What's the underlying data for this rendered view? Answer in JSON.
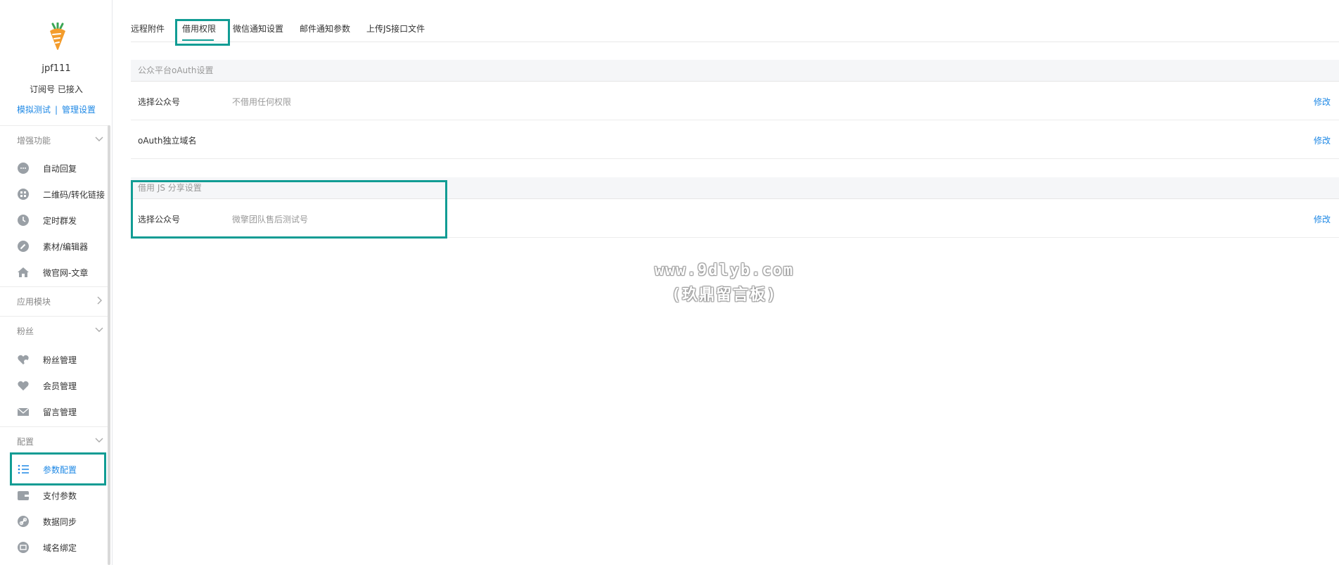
{
  "account": {
    "name": "jpf111",
    "status": "订阅号 已接入",
    "link_test": "模拟测试",
    "link_separator": "|",
    "link_manage": "管理设置"
  },
  "sidebar": {
    "sections": [
      {
        "title": "增强功能",
        "items": [
          "自动回复",
          "二维码/转化链接",
          "定时群发",
          "素材/编辑器",
          "微官网-文章"
        ]
      },
      {
        "title": "应用模块",
        "items": []
      },
      {
        "title": "粉丝",
        "items": [
          "粉丝管理",
          "会员管理",
          "留言管理"
        ]
      },
      {
        "title": "配置",
        "items": [
          "参数配置",
          "支付参数",
          "数据同步",
          "域名绑定"
        ]
      }
    ],
    "active_item": "参数配置"
  },
  "tabs": [
    "远程附件",
    "借用权限",
    "微信通知设置",
    "邮件通知参数",
    "上传JS接口文件"
  ],
  "active_tab": "借用权限",
  "oauth_section": {
    "title": "公众平台oAuth设置",
    "rows": [
      {
        "label": "选择公众号",
        "value": "不借用任何权限",
        "action": "修改"
      },
      {
        "label": "oAuth独立域名",
        "value": "",
        "action": "修改"
      }
    ]
  },
  "js_section": {
    "title": "借用 JS 分享设置",
    "rows": [
      {
        "label": "选择公众号",
        "value": "微擎团队售后测试号",
        "action": "修改"
      }
    ]
  },
  "watermark": {
    "line1": "www.9dlyb.com",
    "line2": "(玖鼎留言板)"
  },
  "colors": {
    "accent": "#1e88e5",
    "highlight": "#119c94",
    "icon": "#9aa0a6"
  }
}
